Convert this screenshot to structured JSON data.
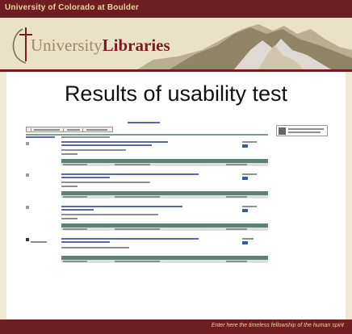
{
  "topbar": {
    "university": "University of Colorado at Boulder"
  },
  "header": {
    "logo_prefix": "University",
    "logo_suffix": "Libraries"
  },
  "slide": {
    "title": "Results of usability test"
  },
  "footer": {
    "tagline": "Enter here the timeless fellowship of the human spirit"
  },
  "colors": {
    "maroon": "#6e1e20",
    "cream": "#efe9d4",
    "table_header": "#5f7f79",
    "link_blue": "#3a4c9a"
  }
}
